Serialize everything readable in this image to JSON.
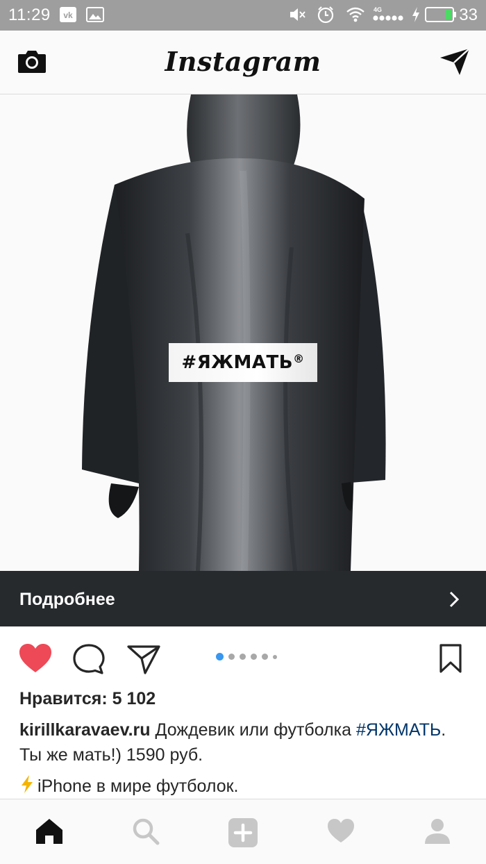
{
  "status_bar": {
    "time": "11:29",
    "battery_level": "33",
    "icons": [
      "vk-icon",
      "image-icon",
      "mute-icon",
      "alarm-icon",
      "wifi-icon",
      "signal-icon",
      "charging-icon",
      "battery-icon"
    ],
    "network": "4G"
  },
  "header": {
    "title": "Instagram",
    "left_icon": "camera-icon",
    "right_icon": "direct-message-icon"
  },
  "post": {
    "image_tag": "#ЯЖМАТЬ",
    "image_tag_mark": "®",
    "more_label": "Подробнее",
    "carousel": {
      "count": 6,
      "active_index": 0
    },
    "likes_text": "Нравится: 5 102",
    "caption": {
      "username": "kirillkaravaev.ru",
      "text_part1": " Дождевик или футболка ",
      "hashtag": "#ЯЖМАТЬ",
      "text_part2": ". Ты же мать!) 1590 руб."
    },
    "next_caption": "iPhone в мире футболок.",
    "colors": {
      "like": "#ed4956",
      "link": "#003569",
      "dot_active": "#3897f0",
      "more_bar": "#262a2d"
    }
  },
  "tabbar": {
    "items": [
      "home-icon",
      "search-icon",
      "add-post-icon",
      "activity-icon",
      "profile-icon"
    ],
    "active": "home-icon"
  }
}
